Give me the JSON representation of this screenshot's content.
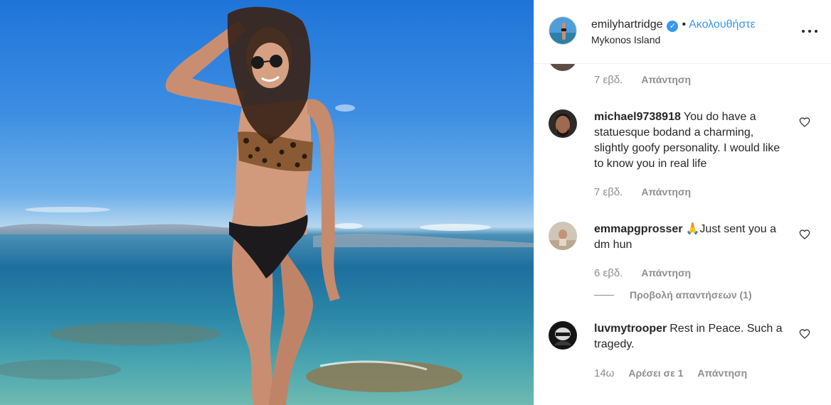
{
  "post": {
    "photo_alt": "Woman in leopard top and black bikini bottoms standing in shallow sea water",
    "author": {
      "username": "emilyhartridge",
      "verified_icon": "verified-badge-icon",
      "separator": "•",
      "follow_label": "Ακολουθήστε",
      "location": "Mykonos Island"
    },
    "more_icon": "more-options-icon"
  },
  "comments": {
    "previous": {
      "time": "7 εβδ.",
      "reply_label": "Απάντηση"
    },
    "items": [
      {
        "username": "michael9738918",
        "text": "You do have a statuesque bodand a charming, slightly goofy personality. I would like to know you in real life",
        "time": "7 εβδ.",
        "reply_label": "Απάντηση"
      },
      {
        "username": "emmapgprosser",
        "emoji": "🙏",
        "text": "Just sent you a dm hun",
        "time": "6 εβδ.",
        "reply_label": "Απάντηση",
        "view_replies": "Προβολή απαντήσεων (1)"
      },
      {
        "username": "luvmytrooper",
        "text": "Rest in Peace. Such a tragedy.",
        "time": "14ω",
        "likes_label": "Αρέσει σε 1",
        "reply_label": "Απάντηση"
      }
    ]
  },
  "colors": {
    "link_blue": "#3897f0",
    "text": "#262626",
    "secondary": "#8e8e8e",
    "border": "#efefef"
  }
}
